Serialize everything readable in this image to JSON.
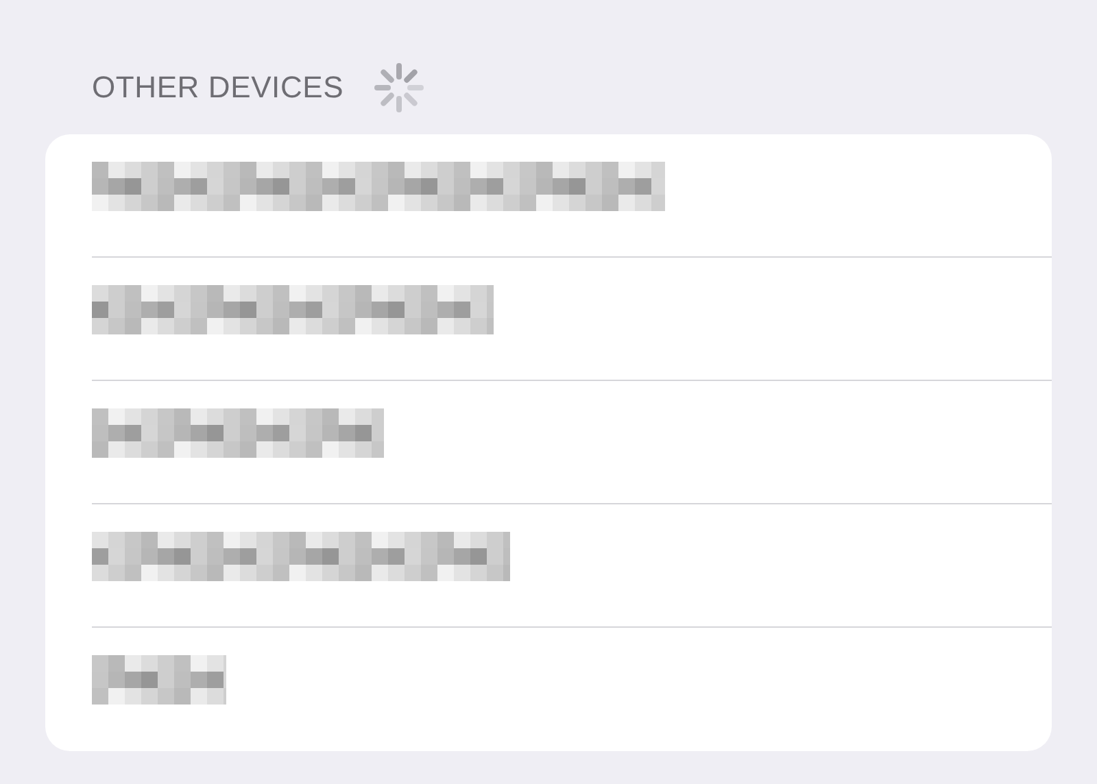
{
  "section": {
    "title": "OTHER DEVICES",
    "loading": true
  },
  "devices": [
    {
      "kind": "redacted"
    },
    {
      "kind": "redacted"
    },
    {
      "kind": "redacted"
    },
    {
      "kind": "redacted"
    },
    {
      "kind": "redacted"
    }
  ]
}
